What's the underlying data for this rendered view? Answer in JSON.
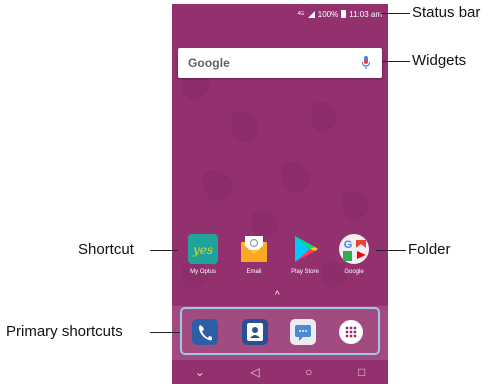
{
  "status_bar": {
    "network": "4G",
    "battery": "100%",
    "time": "11:03 am"
  },
  "search_widget": {
    "logo": "Google"
  },
  "home_apps": [
    {
      "label": "My Optus",
      "icon": "optus-yes-icon"
    },
    {
      "label": "Email",
      "icon": "email-icon"
    },
    {
      "label": "Play Store",
      "icon": "play-store-icon"
    },
    {
      "label": "Google",
      "icon": "google-folder-icon"
    }
  ],
  "dock": [
    {
      "icon": "phone-icon"
    },
    {
      "icon": "contacts-icon"
    },
    {
      "icon": "messages-icon"
    },
    {
      "icon": "app-drawer-icon"
    }
  ],
  "callouts": {
    "status_bar": "Status bar",
    "widgets": "Widgets",
    "shortcut": "Shortcut",
    "folder": "Folder",
    "primary_shortcuts": "Primary shortcuts"
  },
  "colors": {
    "wallpaper": "#93316f",
    "highlight": "#9ec7ea",
    "optus": "#1fa39a"
  }
}
